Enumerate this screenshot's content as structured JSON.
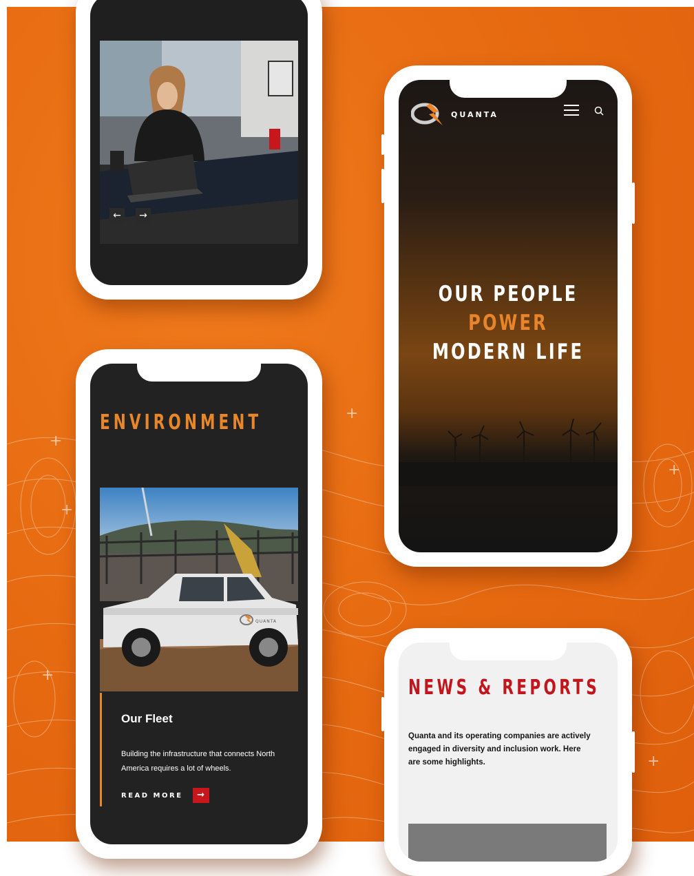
{
  "phone_brand": {
    "logo_text": "QUANTA",
    "menu_icon": "hamburger-menu-icon",
    "search_icon": "search-icon"
  },
  "hero": {
    "line1_prefix": "OUR PEOPLE ",
    "line1_accent": "POWER",
    "line2": "MODERN LIFE"
  },
  "carousel": {
    "prev_label": "←",
    "next_label": "→"
  },
  "environment": {
    "title": "ENVIRONMENT",
    "fleet_title": "Our Fleet",
    "fleet_desc": "Building the infrastructure that connects North America requires a lot of wheels.",
    "read_more": "READ MORE",
    "read_more_arrow": "→",
    "truck_logo_text": "QUANTA"
  },
  "news": {
    "title": "NEWS & REPORTS",
    "desc": "Quanta and its operating companies are actively engaged in diversity and inclusion work. Here are some highlights."
  },
  "colors": {
    "background_orange": "#e86c12",
    "accent_orange": "#e8862a",
    "brand_red": "#c0161c",
    "dark_screen": "#222222"
  }
}
